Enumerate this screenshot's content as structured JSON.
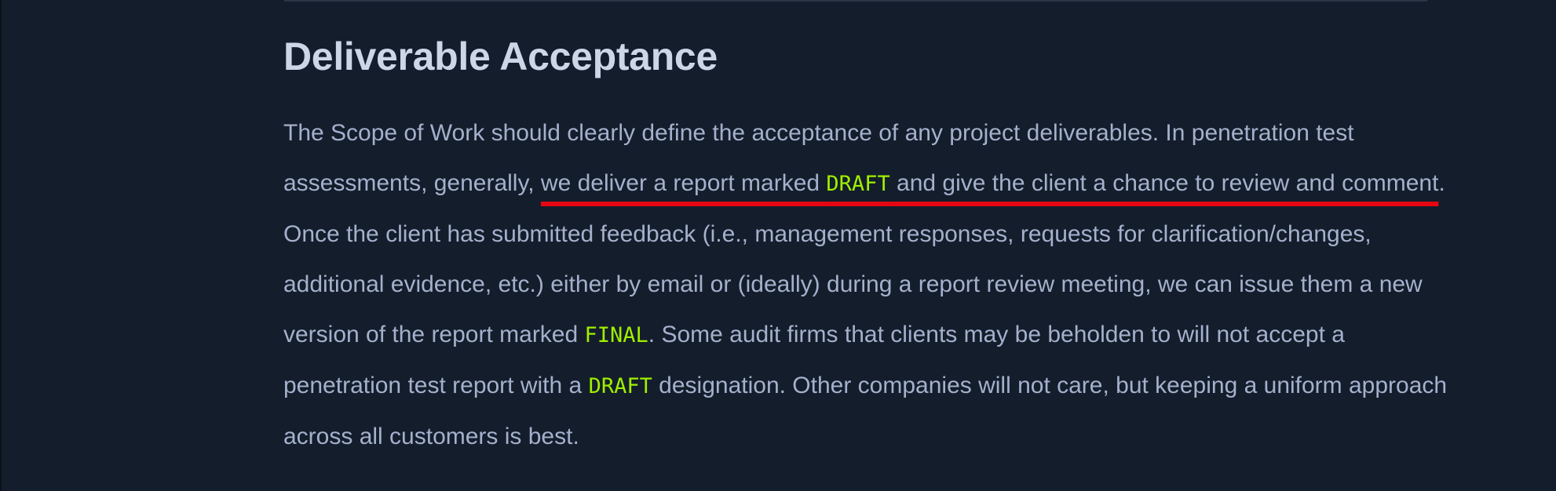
{
  "section": {
    "heading": "Deliverable Acceptance",
    "paragraph": {
      "text_1": "The Scope of Work should clearly define the acceptance of any project deliverables. In penetration test assessments, generally, ",
      "highlight_1": "we deliver a report marked ",
      "code_draft_1": "DRAFT",
      "highlight_2": " and give the client a chance to review and comment",
      "text_2": ". Once the client has submitted feedback (i.e., management responses, requests for clarification/changes, additional evidence, etc.) either by email or (ideally) during a report review meeting, we can issue them a new version of the report marked ",
      "code_final": "FINAL",
      "text_3": ". Some audit firms that clients may be beholden to will not accept a penetration test report with a ",
      "code_draft_2": "DRAFT",
      "text_4": " designation. Other companies will not care, but keeping a uniform approach across all customers is best."
    }
  },
  "colors": {
    "background": "#141d2b",
    "heading": "#cdd6e6",
    "body_text": "#a4b1cd",
    "code_accent": "#9fef00",
    "annotation_underline": "#e40712"
  }
}
